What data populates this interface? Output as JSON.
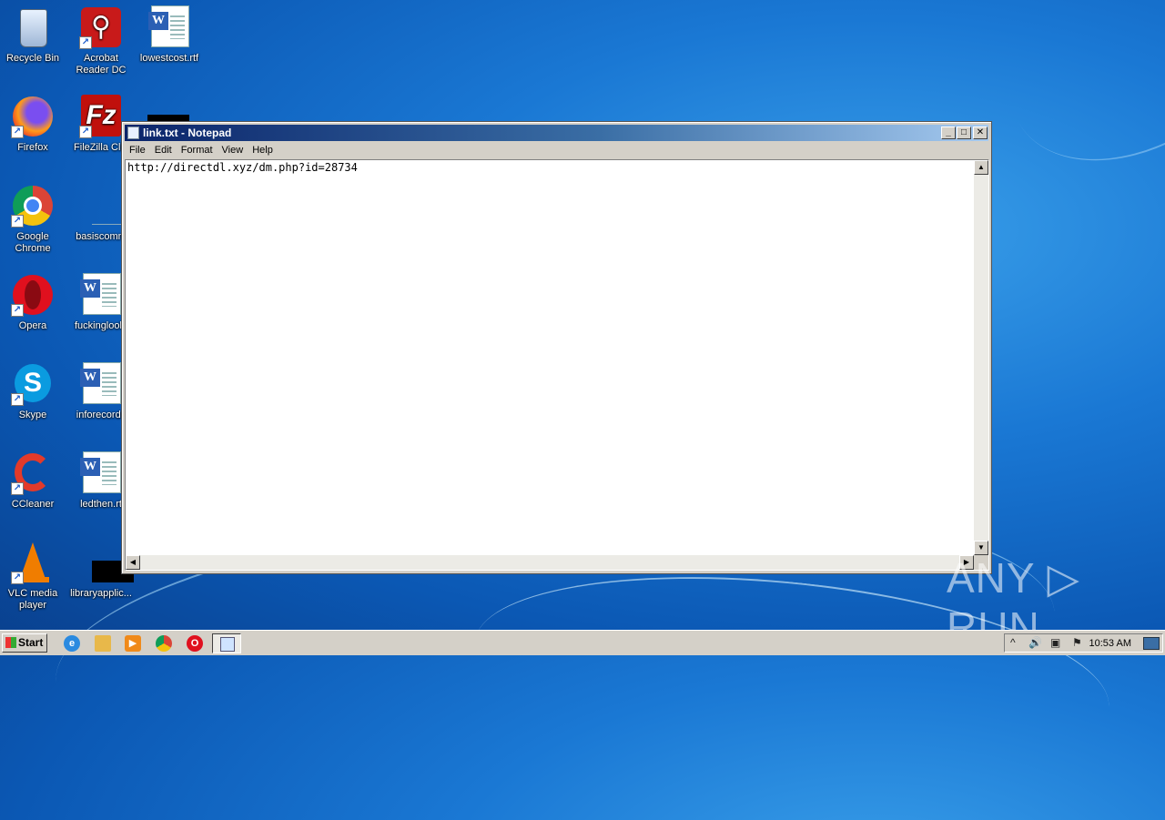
{
  "desktop": {
    "icons": [
      {
        "label": "Recycle Bin",
        "icon": "recycle-bin-icon"
      },
      {
        "label": "Acrobat Reader DC",
        "icon": "acrobat-icon"
      },
      {
        "label": "lowestcost.rtf",
        "icon": "word-document-icon"
      },
      {
        "label": "Firefox",
        "icon": "firefox-icon"
      },
      {
        "label": "FileZilla Clie",
        "icon": "filezilla-icon"
      },
      {
        "label": "Google Chrome",
        "icon": "chrome-icon"
      },
      {
        "label": "basiscomm",
        "icon": "file-icon"
      },
      {
        "label": "Opera",
        "icon": "opera-icon"
      },
      {
        "label": "fuckinglook.",
        "icon": "word-document-icon"
      },
      {
        "label": "Skype",
        "icon": "skype-icon"
      },
      {
        "label": "inforecords",
        "icon": "word-document-icon"
      },
      {
        "label": "CCleaner",
        "icon": "ccleaner-icon"
      },
      {
        "label": "ledthen.rt",
        "icon": "word-document-icon"
      },
      {
        "label": "VLC media player",
        "icon": "vlc-icon"
      },
      {
        "label": "libraryapplic...",
        "icon": "black-thumbnail-icon"
      }
    ]
  },
  "notepad": {
    "title": "link.txt - Notepad",
    "buttons": {
      "minimize": "_",
      "maximize": "□",
      "close": "✕"
    },
    "menu": [
      "File",
      "Edit",
      "Format",
      "View",
      "Help"
    ],
    "content": "http://directdl.xyz/dm.php?id=28734",
    "scroll": {
      "up": "▲",
      "down": "▼",
      "left": "◀",
      "right": "▶"
    }
  },
  "taskbar": {
    "start_label": "Start",
    "clock": "10:53 AM",
    "tray": {
      "expand": "^",
      "volume": "🔊",
      "network": "▣",
      "flag": "⚑"
    }
  },
  "watermark": "ANY ▷ RUN",
  "colors": {
    "titlebar_start": "#0a246a",
    "titlebar_end": "#a6caf0",
    "desktop": "#1a78d4"
  }
}
